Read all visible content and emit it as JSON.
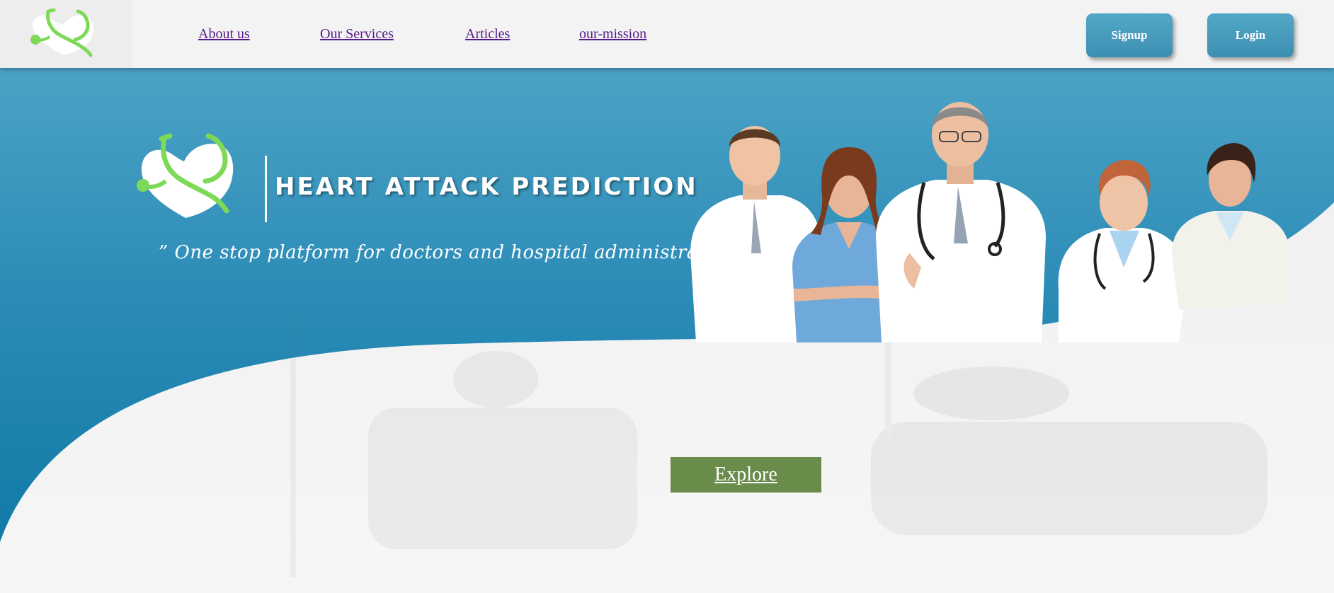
{
  "nav": {
    "links": [
      {
        "label": "About us"
      },
      {
        "label": "Our Services"
      },
      {
        "label": "Articles"
      },
      {
        "label": "our-mission"
      }
    ],
    "signup_label": "Signup",
    "login_label": "Login",
    "logo_icon": "heart-stethoscope-icon"
  },
  "hero": {
    "title": "HEART ATTACK PREDICTION",
    "tagline": "” One stop platform for doctors and hospital administration ”",
    "logo_icon": "heart-stethoscope-icon",
    "image": "team-of-doctors-photo",
    "background_image": "patient-in-hospital-bed-photo",
    "explore_label": "Explore"
  },
  "colors": {
    "hero_blue": "#3f9cc2",
    "hero_blue_dark": "#0f7aa6",
    "button_blue": "#4a9dbe",
    "explore_green": "#6a8c4a",
    "link_purple": "#551a8b",
    "logo_green": "#7ed957"
  }
}
